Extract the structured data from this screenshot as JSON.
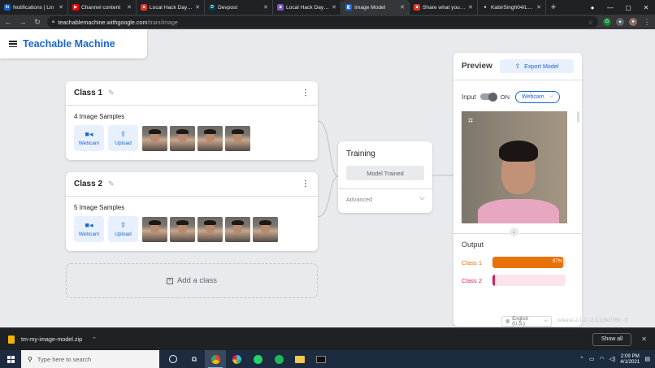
{
  "browser": {
    "tabs": [
      {
        "title": "Notifications | Lin",
        "favicon": "linkedin-icon",
        "color": "#0a66c2",
        "glyph": "in",
        "active": false
      },
      {
        "title": "Channel content",
        "favicon": "youtube-icon",
        "color": "#ff0000",
        "glyph": "▶",
        "active": false
      },
      {
        "title": "Local Hack Day: S",
        "favicon": "mlh-icon",
        "color": "#e73427",
        "glyph": "■",
        "active": false
      },
      {
        "title": "Devpost",
        "favicon": "devpost-icon",
        "color": "#003e54",
        "glyph": "D",
        "active": false
      },
      {
        "title": "Local Hack Day: S",
        "favicon": "mlh-icon",
        "color": "#7e57c2",
        "glyph": "■",
        "active": false
      },
      {
        "title": "Image Model",
        "favicon": "teachable-machine-icon",
        "color": "#1967d2",
        "glyph": "◧",
        "active": true
      },
      {
        "title": "Share what you've",
        "favicon": "mlh-icon",
        "color": "#e73427",
        "glyph": "■",
        "active": false
      },
      {
        "title": "KabirSingh04/LHC",
        "favicon": "github-icon",
        "color": "#ffffff",
        "glyph": "●",
        "active": false
      }
    ],
    "new_tab": "+",
    "url_host": "teachablemachine.withgoogle.com",
    "url_path": "/train/image"
  },
  "app": {
    "brand": "Teachable Machine"
  },
  "classes": [
    {
      "name": "Class 1",
      "samples_label": "4 Image Samples",
      "thumbnails": 4
    },
    {
      "name": "Class 2",
      "samples_label": "5 Image Samples",
      "thumbnails": 5
    }
  ],
  "source_buttons": {
    "webcam": "Webcam",
    "upload": "Upload"
  },
  "add_class": "Add a class",
  "training": {
    "title": "Training",
    "button": "Model Trained",
    "advanced": "Advanced"
  },
  "preview": {
    "title": "Preview",
    "export": "Export Model",
    "input_label": "Input",
    "toggle_state": "ON",
    "input_source": "Webcam",
    "output_label": "Output",
    "outputs": [
      {
        "label": "Class 1",
        "percent": 97,
        "percent_label": "97%",
        "color": "#e8710a"
      },
      {
        "label": "Class 2",
        "percent": 3,
        "percent_label": "",
        "color": "#d81b60"
      }
    ]
  },
  "footer": {
    "language": "English (U.S.)",
    "version": "release-2-1-1 - 2.3.1d3c7769 - tf"
  },
  "downloads": {
    "file": "tm-my-image-model.zip",
    "show_all": "Show all"
  },
  "taskbar": {
    "search_placeholder": "Type here to search",
    "time": "2:09 PM",
    "date": "4/1/2021"
  }
}
